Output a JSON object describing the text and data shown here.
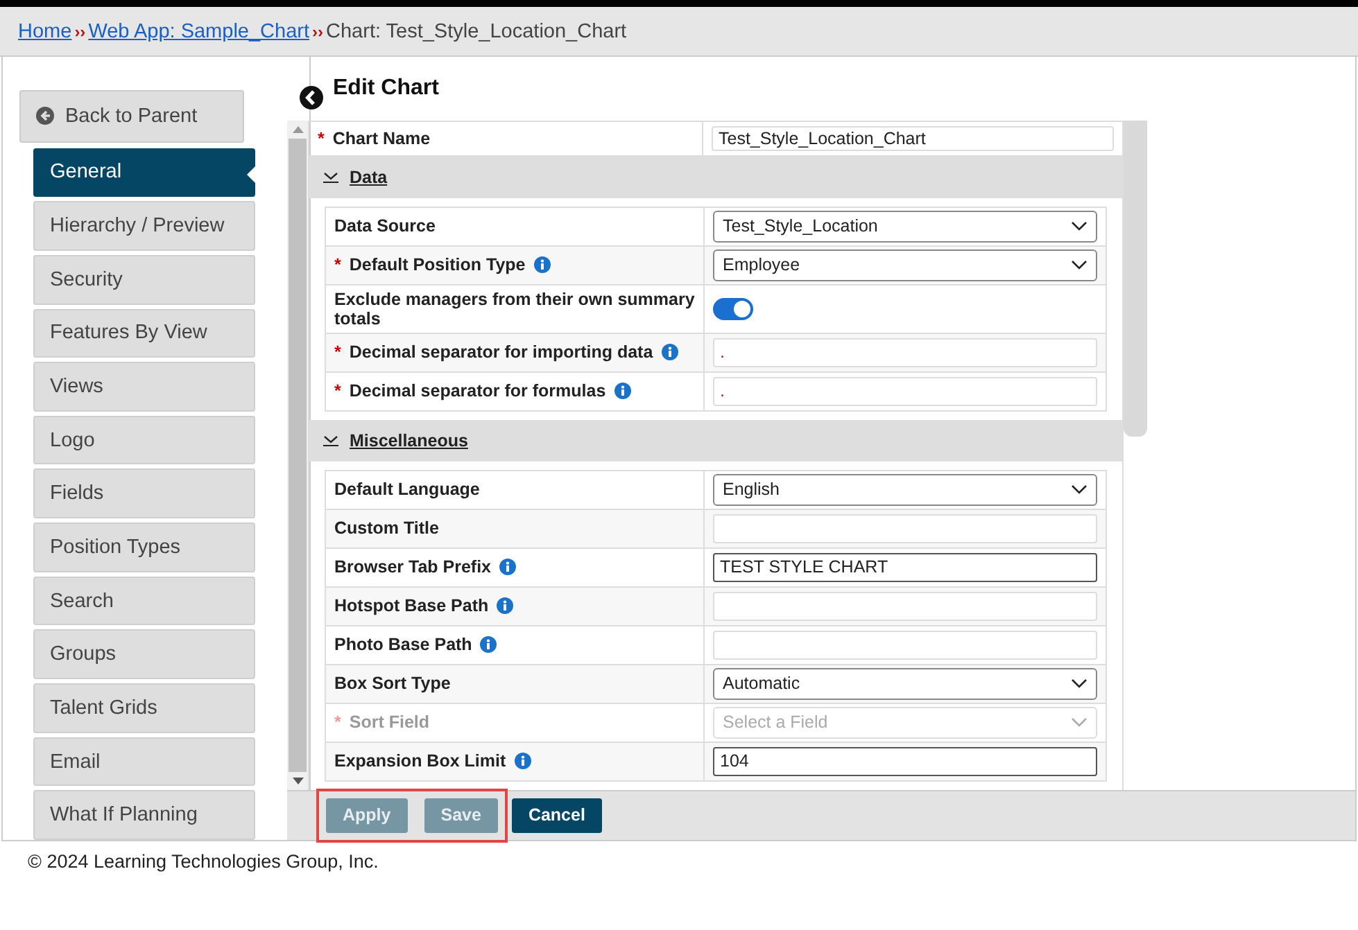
{
  "breadcrumb": {
    "separator": "››",
    "items": [
      {
        "label": "Home",
        "kind": "link"
      },
      {
        "label": "Web App: Sample_Chart",
        "kind": "link"
      },
      {
        "label": "Chart: Test_Style_Location_Chart",
        "kind": "text"
      }
    ]
  },
  "sidebar": {
    "back_button": "Back to Parent",
    "items": [
      {
        "label": "General",
        "selected": true
      },
      {
        "label": "Hierarchy / Preview",
        "selected": false
      },
      {
        "label": "Security",
        "selected": false
      },
      {
        "label": "Features By View",
        "selected": false
      },
      {
        "label": "Views",
        "selected": false
      },
      {
        "label": "Logo",
        "selected": false
      },
      {
        "label": "Fields",
        "selected": false
      },
      {
        "label": "Position Types",
        "selected": false
      },
      {
        "label": "Search",
        "selected": false
      },
      {
        "label": "Groups",
        "selected": false
      },
      {
        "label": "Talent Grids",
        "selected": false
      },
      {
        "label": "Email",
        "selected": false
      },
      {
        "label": "What If Planning",
        "selected": false
      }
    ]
  },
  "page_title": "Edit Chart",
  "form": {
    "required_mark": "*",
    "chart_name": {
      "label": "Chart Name",
      "required": true,
      "value": "Test_Style_Location_Chart"
    },
    "sections": [
      {
        "title": "Data",
        "expanded": true,
        "rows": [
          {
            "label": "Data Source",
            "required": false,
            "info": false,
            "disabled": false,
            "kind": "select",
            "value": "Test_Style_Location"
          },
          {
            "label": "Default Position Type",
            "required": true,
            "info": true,
            "disabled": false,
            "kind": "select",
            "value": "Employee"
          },
          {
            "label": "Exclude managers from their own summary totals",
            "required": false,
            "info": false,
            "disabled": false,
            "kind": "toggle",
            "on": true
          },
          {
            "label": "Decimal separator for importing data",
            "required": true,
            "info": true,
            "disabled": false,
            "kind": "text",
            "value": "."
          },
          {
            "label": "Decimal separator for formulas",
            "required": true,
            "info": true,
            "disabled": false,
            "kind": "text",
            "value": "."
          }
        ]
      },
      {
        "title": "Miscellaneous",
        "expanded": true,
        "rows": [
          {
            "label": "Default Language",
            "required": false,
            "info": false,
            "disabled": false,
            "kind": "select",
            "value": "English"
          },
          {
            "label": "Custom Title",
            "required": false,
            "info": false,
            "disabled": false,
            "kind": "text"
          },
          {
            "label": "Browser Tab Prefix",
            "required": false,
            "info": true,
            "disabled": false,
            "kind": "text",
            "value": "TEST STYLE CHART"
          },
          {
            "label": "Hotspot Base Path",
            "required": false,
            "info": true,
            "disabled": false,
            "kind": "text"
          },
          {
            "label": "Photo Base Path",
            "required": false,
            "info": true,
            "disabled": false,
            "kind": "text"
          },
          {
            "label": "Box Sort Type",
            "required": false,
            "info": false,
            "disabled": false,
            "kind": "select",
            "value": "Automatic"
          },
          {
            "label": "Sort Field",
            "required": true,
            "info": false,
            "disabled": true,
            "kind": "select",
            "placeholder": "Select a Field"
          },
          {
            "label": "Expansion Box Limit",
            "required": false,
            "info": true,
            "disabled": false,
            "kind": "text",
            "value": "104"
          }
        ]
      }
    ]
  },
  "buttons": [
    {
      "label": "Apply",
      "disabled": true,
      "highlighted": true
    },
    {
      "label": "Save",
      "disabled": true,
      "highlighted": true
    },
    {
      "label": "Cancel",
      "disabled": false,
      "highlighted": false
    }
  ],
  "footer": "© 2024 Learning Technologies Group, Inc."
}
